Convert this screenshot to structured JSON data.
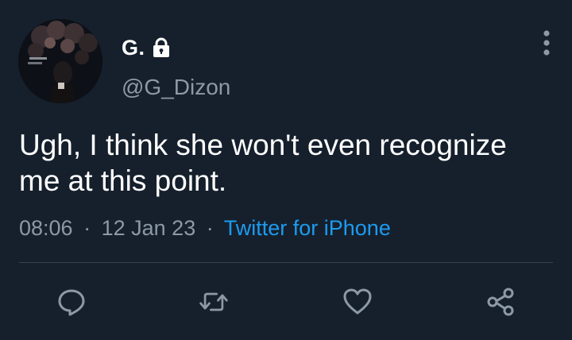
{
  "user": {
    "display_name": "G.",
    "handle": "@G_Dizon",
    "avatar_icon": "profile-photo",
    "protected_icon": "lock-icon"
  },
  "tweet": {
    "text": "Ugh, I think she won't even recognize me at this point.",
    "time": "08:06",
    "separator": "·",
    "date": "12 Jan 23",
    "source": "Twitter for iPhone"
  },
  "actions": [
    {
      "name": "reply",
      "icon": "reply-icon"
    },
    {
      "name": "retweet",
      "icon": "retweet-icon"
    },
    {
      "name": "like",
      "icon": "heart-icon"
    },
    {
      "name": "share",
      "icon": "share-icon"
    }
  ],
  "menu_icon": "more-options-icon",
  "colors": {
    "background": "#16202c",
    "text": "#ffffff",
    "secondary_text": "#8d99a6",
    "link": "#1d9bf0",
    "divider": "#38444d"
  }
}
